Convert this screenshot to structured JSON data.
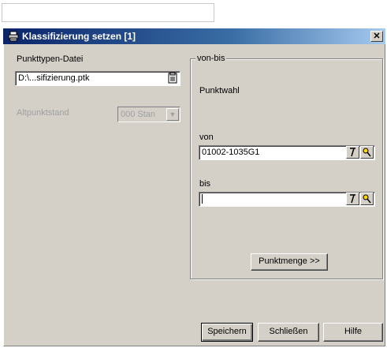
{
  "window": {
    "title": "Klassifizierung setzen [1]",
    "close_glyph": "✕"
  },
  "left": {
    "punkttypen_label": "Punkttypen-Datei",
    "punkttypen_value": "D:\\...sifizierung.ptk",
    "altpunktstand_label": "Altpunktstand",
    "altpunktstand_value": "000   Stan"
  },
  "group": {
    "title": "von-bis",
    "punktwahl_label": "Punktwahl",
    "von_label": "von",
    "von_value": "01002-1035G1",
    "bis_label": "bis",
    "bis_value": "",
    "punktmenge_button": "Punktmenge >>"
  },
  "footer": {
    "speichern": "Speichern",
    "schliessen": "Schließen",
    "hilfe": "Hilfe"
  },
  "icons": {
    "window": "printer-icon",
    "file_browse": "document-icon",
    "pick": "pick-point-icon",
    "search": "search-person-icon"
  }
}
